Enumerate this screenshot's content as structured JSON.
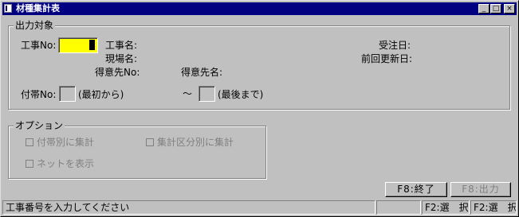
{
  "window": {
    "title": "材種集計表",
    "min_glyph": "_",
    "max_glyph": "□",
    "close_glyph": "×"
  },
  "target": {
    "legend": "出力対象",
    "koji_no_label": "工事No:",
    "koji_no_value": "",
    "koji_name_label": "工事名:",
    "genba_name_label": "現場名:",
    "tokui_no_label": "得意先No:",
    "tokui_name_label": "得意先名:",
    "juchu_date_label": "受注日:",
    "prev_update_label": "前回更新日:",
    "futai_no_label": "付帯No:",
    "from_note": "(最初から)",
    "tilde": "～",
    "to_note": "(最後まで)"
  },
  "options": {
    "legend": "オプション",
    "by_futai": "付帯別に集計",
    "by_category": "集計区分別に集計",
    "show_net": "ネットを表示"
  },
  "buttons": {
    "exit": "F8:終了",
    "output": "F8:出力"
  },
  "statusbar": {
    "message": "工事番号を入力してください",
    "f2_a": "F2:選　択",
    "f2_b": "F2:選　択"
  },
  "colors": {
    "titlebar": "#000080",
    "input_highlight": "#ffff00",
    "face": "#c0c0c0"
  }
}
